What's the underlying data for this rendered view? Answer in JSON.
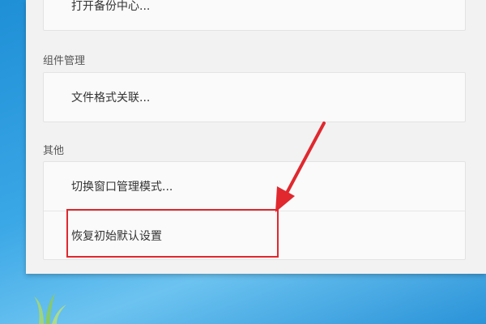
{
  "backup": {
    "label": "打开备份中心..."
  },
  "components": {
    "section_title": "组件管理",
    "file_assoc_label": "文件格式关联..."
  },
  "other": {
    "section_title": "其他",
    "switch_window_mode_label": "切换窗口管理模式...",
    "restore_defaults_label": "恢复初始默认设置"
  },
  "colors": {
    "highlight": "#e0282e",
    "panel_bg": "#f2f2f2",
    "card_bg": "#fafafa"
  }
}
